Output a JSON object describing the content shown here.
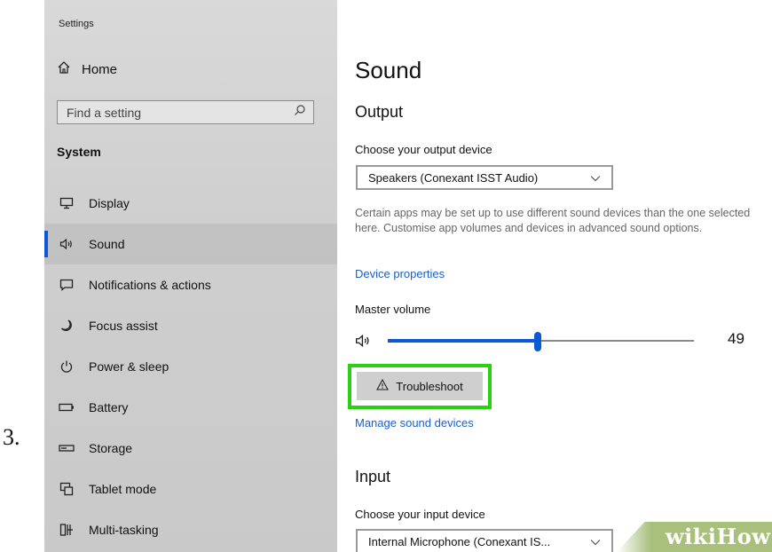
{
  "step_number": "3.",
  "window": {
    "title": "Settings"
  },
  "sidebar": {
    "home_label": "Home",
    "search_placeholder": "Find a setting",
    "section_label": "System",
    "items": [
      {
        "label": "Display",
        "icon": "monitor-icon"
      },
      {
        "label": "Sound",
        "icon": "speaker-icon",
        "active": true
      },
      {
        "label": "Notifications & actions",
        "icon": "message-icon"
      },
      {
        "label": "Focus assist",
        "icon": "moon-icon"
      },
      {
        "label": "Power & sleep",
        "icon": "power-icon"
      },
      {
        "label": "Battery",
        "icon": "battery-icon"
      },
      {
        "label": "Storage",
        "icon": "storage-icon"
      },
      {
        "label": "Tablet mode",
        "icon": "tablet-icon"
      },
      {
        "label": "Multi-tasking",
        "icon": "multitask-icon"
      }
    ]
  },
  "main": {
    "title": "Sound",
    "output": {
      "heading": "Output",
      "device_label": "Choose your output device",
      "device_value": "Speakers (Conexant ISST Audio)",
      "description": "Certain apps may be set up to use different sound devices than the one selected here. Customise app volumes and devices in advanced sound options.",
      "device_properties_link": "Device properties",
      "master_volume_label": "Master volume",
      "volume_value": "49",
      "troubleshoot_label": "Troubleshoot",
      "manage_link": "Manage sound devices"
    },
    "input": {
      "heading": "Input",
      "device_label": "Choose your input device",
      "device_value": "Internal Microphone (Conexant IS..."
    }
  },
  "watermark": {
    "part1": "wiki",
    "part2": "How"
  },
  "colors": {
    "accent": "#0a5bd3",
    "highlight": "#2dcf13",
    "link": "#1a5fc8"
  }
}
